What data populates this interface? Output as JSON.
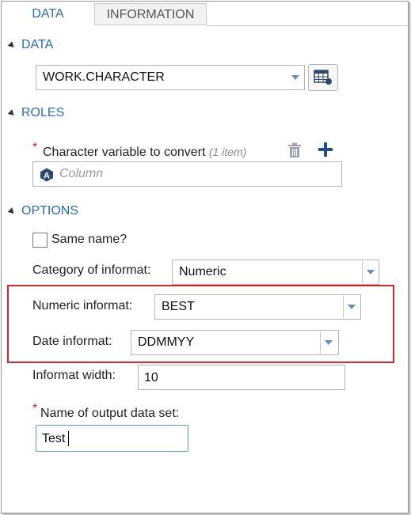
{
  "tabs": [
    {
      "label": "DATA",
      "active": true
    },
    {
      "label": "INFORMATION",
      "active": false
    }
  ],
  "data_section": {
    "header": "DATA",
    "dataset_value": "WORK.CHARACTER"
  },
  "roles_section": {
    "header": "ROLES",
    "char_var_label": "Character variable to convert",
    "char_var_count": "(1 item)",
    "column_placeholder": "Column"
  },
  "options_section": {
    "header": "OPTIONS",
    "same_name_label": "Same name?",
    "same_name_checked": false,
    "category_label": "Category of informat:",
    "category_value": "Numeric",
    "numeric_informat_label": "Numeric informat:",
    "numeric_informat_value": "BEST",
    "date_informat_label": "Date informat:",
    "date_informat_value": "DDMMYY",
    "informat_width_label": "Informat width:",
    "informat_width_value": "10",
    "output_label": "Name of output data set:",
    "output_value": "Test"
  },
  "required_marker": "*",
  "colors": {
    "accent": "#2a6db3",
    "required": "#d0221b",
    "highlight_box": "#d9262a",
    "focus_border": "#5b9bd5"
  }
}
